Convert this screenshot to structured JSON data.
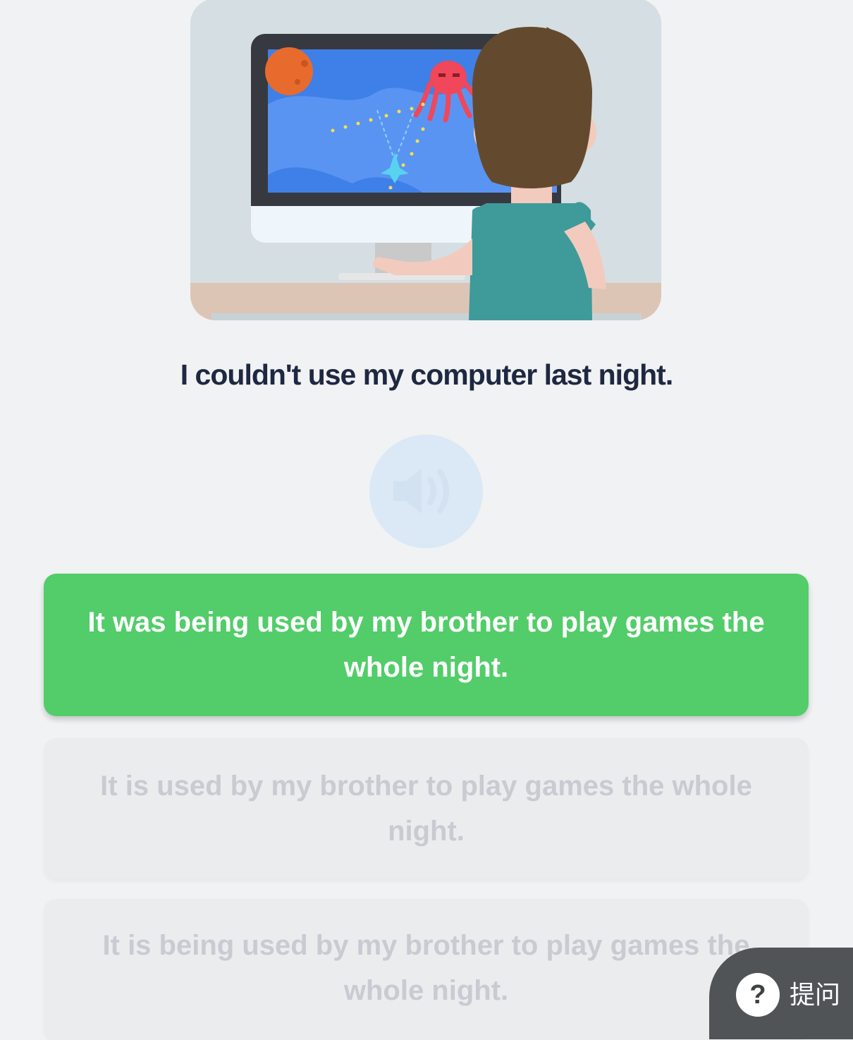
{
  "question": {
    "sentence": "I couldn't use my computer last night."
  },
  "audio": {
    "icon": "speaker-icon"
  },
  "options": [
    {
      "text": "It was being used by my brother to play games the whole night.",
      "state": "selected"
    },
    {
      "text": "It is used by my brother to play games the whole night.",
      "state": "dimmed"
    },
    {
      "text": "It is being used by my brother to play games the whole night.",
      "state": "dimmed"
    }
  ],
  "ask_button": {
    "icon_glyph": "?",
    "label": "提问"
  },
  "colors": {
    "selected_option": "#52cd69",
    "dimmed_option": "#ebecee",
    "dimmed_text": "#c8cbd1",
    "sentence_text": "#1f2841",
    "background": "#f1f2f4",
    "audio_button": "#dbe8f5",
    "ask_button": "#505456"
  }
}
